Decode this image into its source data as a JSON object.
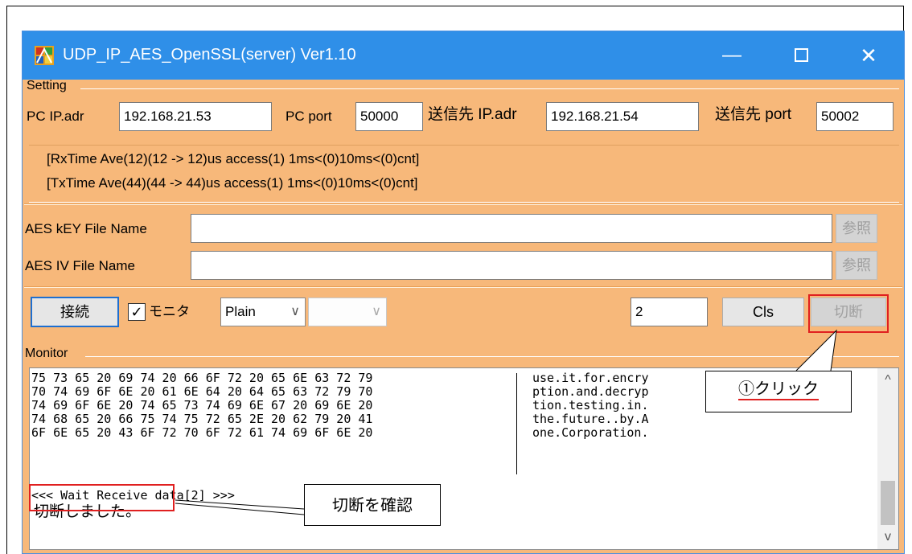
{
  "window": {
    "title": "UDP_IP_AES_OpenSSL(server) Ver1.10",
    "min_glyph": "—",
    "close_glyph": "✕"
  },
  "setting": {
    "group_label": "Setting",
    "pc_ip_label": "PC IP.adr",
    "pc_ip_value": "192.168.21.53",
    "pc_port_label": "PC port",
    "pc_port_value": "50000",
    "dest_ip_label": "送信先 IP.adr",
    "dest_ip_value": "192.168.21.54",
    "dest_port_label": "送信先 port",
    "dest_port_value": "50002"
  },
  "status": {
    "rx_line": "[RxTime Ave(12)(12 -> 12)us access(1) 1ms<(0)10ms<(0)cnt]",
    "tx_line": "[TxTime Ave(44)(44 -> 44)us access(1) 1ms<(0)10ms<(0)cnt]"
  },
  "aes": {
    "key_label": "AES kEY File Name",
    "key_value": "",
    "key_browse": "参照",
    "iv_label": "AES IV File Name",
    "iv_value": "",
    "iv_browse": "参照"
  },
  "controls": {
    "connect_label": "接続",
    "monitor_check_glyph": "✓",
    "monitor_check_label": "モニタ",
    "mode_value": "Plain",
    "mode2_value": "",
    "count_value": "2",
    "cls_label": "Cls",
    "disconnect_label": "切断"
  },
  "monitor": {
    "group_label": "Monitor",
    "hex": "75 73 65 20 69 74 20 66 6F 72 20 65 6E 63 72 79\n70 74 69 6F 6E 20 61 6E 64 20 64 65 63 72 79 70\n74 69 6F 6E 20 74 65 73 74 69 6E 67 20 69 6E 20\n74 68 65 20 66 75 74 75 72 65 2E 20 62 79 20 41\n6F 6E 65 20 43 6F 72 70 6F 72 61 74 69 6F 6E 20",
    "ascii": "use.it.for.encry\nption.and.decryp\ntion.testing.in.\nthe.future..by.A\none.Corporation.",
    "wait_line": "<<< Wait Receive data[2] >>>",
    "done_line": "切断しました。",
    "scroll_up": "^",
    "scroll_down": "v"
  },
  "annotations": {
    "click_note": "①クリック",
    "confirm_note": "切断を確認"
  },
  "colors": {
    "titlebar": "#2f8fe8",
    "window_bg": "#f7b87a",
    "highlight_red": "#e02020"
  }
}
